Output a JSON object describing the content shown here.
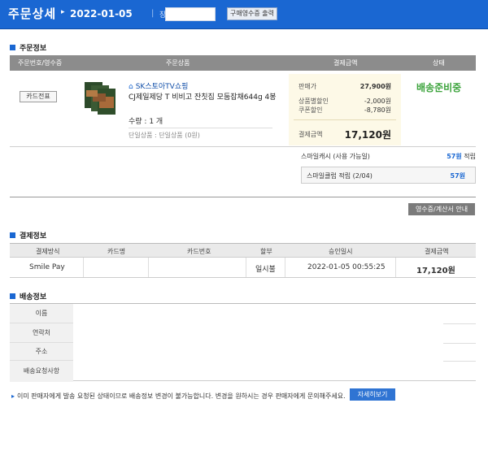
{
  "header": {
    "title": "주문상세",
    "date": "2022-01-05",
    "cart_label": "장바구니",
    "print_button": "구매영수증 출력"
  },
  "order_info": {
    "section_title": "주문정보",
    "columns": [
      "주문번호/영수증",
      "주문상품",
      "결제금액",
      "상태"
    ],
    "card_receipt_button": "카드전표",
    "seller": "SK스토아TV쇼핑",
    "product_name": "CJ제일제당 T 비비고 잔칫집 모둠잡채644g 4봉",
    "quantity": "수량 : 1 개",
    "option": "단일상품 : 단일상품 (0원)",
    "price_label": "판매가",
    "price_value": "27,900원",
    "discount1_label": "상품별할인",
    "discount1_value": "-2,000원",
    "discount2_label": "쿠폰할인",
    "discount2_value": "-8,780원",
    "total_label": "결제금액",
    "total_value": "17,120원",
    "status": "배송준비중",
    "smile_label": "스마일캐시 (사용 가능일)",
    "smile_value": "57원",
    "smile_suffix": "적립",
    "smile_club_label": "스마일클럽 적립 (2/04)",
    "smile_club_value": "57원",
    "receipt_button": "영수증/계산서 안내"
  },
  "payment_info": {
    "section_title": "결제정보",
    "columns": [
      "결제방식",
      "카드명",
      "카드번호",
      "할부",
      "승인일시",
      "결제금액"
    ],
    "method": "Smile Pay",
    "card_name": "",
    "card_number": "",
    "installment": "일시불",
    "approved_at": "2022-01-05 00:55:25",
    "amount": "17,120원"
  },
  "shipping_info": {
    "section_title": "배송정보",
    "labels": [
      "이름",
      "연락처",
      "주소",
      "배송요청사항"
    ],
    "notice": "이미 판매자에게 발송 요청된 상태이므로 배송정보 변경이 불가능합니다. 변경을 원하시는 경우 판매자에게 문의해주세요.",
    "detail_button": "자세히보기"
  },
  "colors": {
    "header_blue": "#1a67d2",
    "status_green": "#3ba33b"
  }
}
